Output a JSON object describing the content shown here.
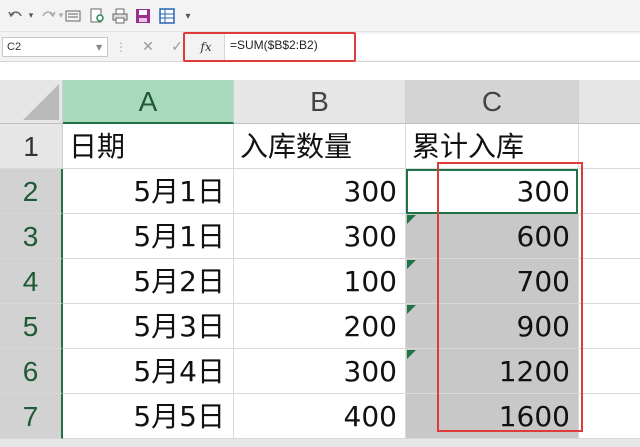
{
  "toolbar": {
    "items": [
      "undo-icon",
      "redo-icon",
      "form-icon",
      "print-preview-icon",
      "print-icon",
      "save-icon",
      "grid-icon",
      "customize-arrow"
    ],
    "customize_glyph": "▾"
  },
  "formula_bar": {
    "name_box": "C2",
    "cancel_glyph": "✕",
    "enter_glyph": "✓",
    "fx_label": "fx",
    "formula": "=SUM($B$2:B2)",
    "highlight_color": "#e03b3b"
  },
  "grid": {
    "columns": [
      "A",
      "B",
      "C"
    ],
    "rows": [
      "1",
      "2",
      "3",
      "4",
      "5",
      "6",
      "7"
    ],
    "header_row": [
      "日期",
      "入库数量",
      "累计入库"
    ],
    "data": [
      [
        "5月1日",
        "300",
        "300"
      ],
      [
        "5月1日",
        "300",
        "600"
      ],
      [
        "5月2日",
        "100",
        "700"
      ],
      [
        "5月3日",
        "200",
        "900"
      ],
      [
        "5月4日",
        "300",
        "1200"
      ],
      [
        "5月5日",
        "400",
        "1600"
      ]
    ],
    "selected_column": "C",
    "active_cell": "C2",
    "accent_color": "#217346"
  }
}
